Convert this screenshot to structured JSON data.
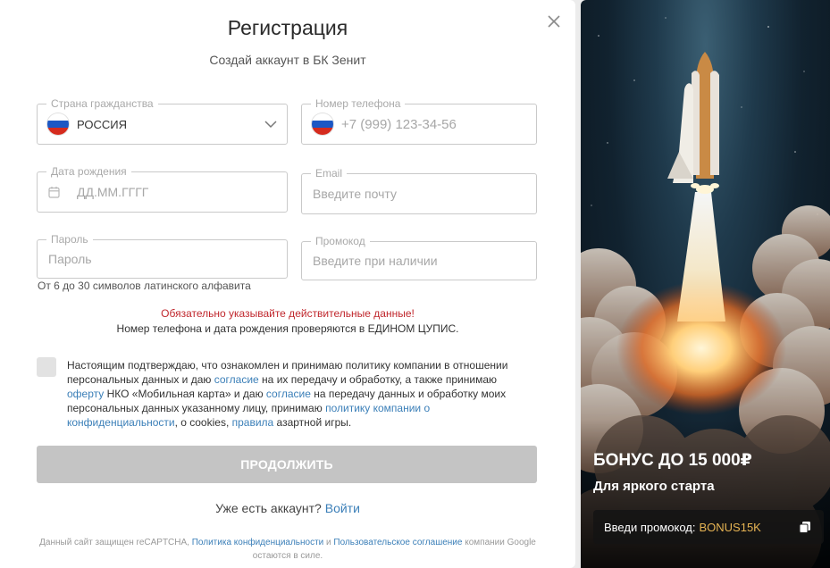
{
  "form": {
    "title": "Регистрация",
    "subtitle": "Создай аккаунт в БК Зенит",
    "fields": {
      "country": {
        "label": "Страна гражданства",
        "value": "РОССИЯ"
      },
      "phone": {
        "label": "Номер телефона",
        "placeholder": "+7 (999) 123-34-56"
      },
      "birth": {
        "label": "Дата рождения",
        "placeholder": "ДД.ММ.ГГГГ"
      },
      "email": {
        "label": "Email",
        "placeholder": "Введите почту"
      },
      "password": {
        "label": "Пароль",
        "placeholder": "Пароль",
        "hint": "От 6 до 30 символов латинского алфавита"
      },
      "promo": {
        "label": "Промокод",
        "placeholder": "Введите при наличии"
      }
    },
    "warning": "Обязательно указывайте действительные данные!",
    "warning_note": "Номер телефона и дата рождения проверяются в ЕДИНОМ ЦУПИС.",
    "consent": {
      "t1": "Настоящим подтверждаю, что ознакомлен и принимаю политику компании в отношении персональных данных и даю ",
      "l1": "согласие",
      "t2": " на их передачу и обработку, а также принимаю ",
      "l2": "оферту",
      "t3": " НКО «Мобильная карта» и даю ",
      "l3": "согласие",
      "t4": " на передачу данных и обработку моих персональных данных указанному лицу, принимаю ",
      "l4": "политику компании о конфиденциальности",
      "t5": ", о cookies, ",
      "l5": "правила",
      "t6": " азартной игры."
    },
    "submit_label": "ПРОДОЛЖИТЬ",
    "have_account": "Уже есть аккаунт?",
    "login_link": "Войти",
    "recaptcha": {
      "t1": "Данный сайт защищен reCAPTCHA, ",
      "l1": "Политика конфиденциальности",
      "t2": " и ",
      "l2": "Пользовательское соглашение",
      "t3": " компании Google остаются в силе."
    }
  },
  "promo_panel": {
    "bonus_title": "БОНУС ДО 15 000₽",
    "bonus_subtitle": "Для яркого старта",
    "promo_prefix": "Введи промокод:",
    "promo_code": "BONUS15K"
  },
  "icons": {
    "close": "close-icon",
    "chevron": "chevron-down-icon",
    "calendar": "calendar-icon",
    "copy": "copy-icon",
    "flag": "russia-flag-icon"
  },
  "colors": {
    "link": "#3b7fb8",
    "warning": "#c0272d",
    "button_disabled": "#c4c4c4",
    "promo_code": "#e6b453"
  }
}
